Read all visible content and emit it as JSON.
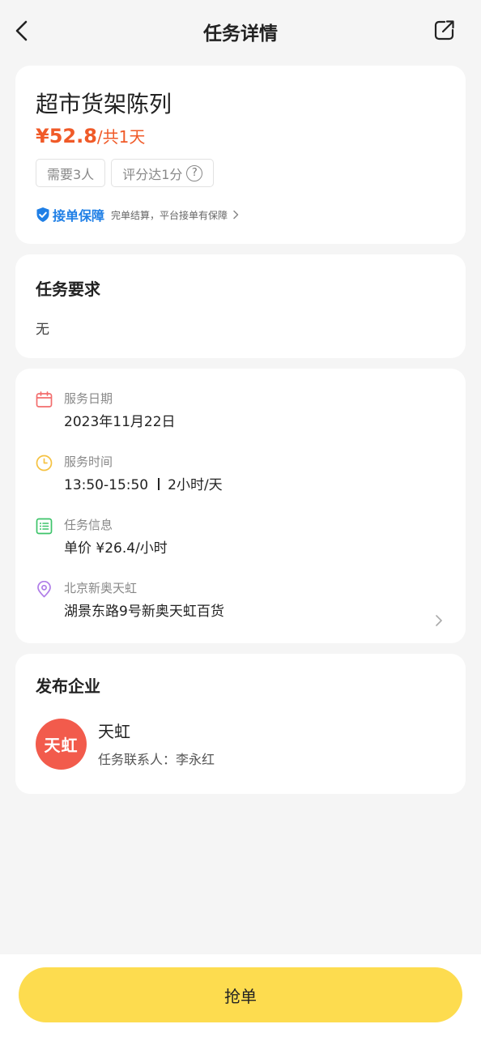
{
  "header": {
    "title": "任务详情"
  },
  "task": {
    "name": "超市货架陈列",
    "price": "¥52.8",
    "price_suffix": "/共1天",
    "tags": [
      "需要3人",
      "评分达1分"
    ],
    "guarantee_title": "接单保障",
    "guarantee_desc": "完单结算，平台接单有保障"
  },
  "requirements": {
    "title": "任务要求",
    "text": "无"
  },
  "details": {
    "date_label": "服务日期",
    "date_value": "2023年11月22日",
    "time_label": "服务时间",
    "time_range": "13:50-15:50",
    "time_duration": "2小时/天",
    "info_label": "任务信息",
    "info_value": "单价 ¥26.4/小时",
    "location_label": "北京新奥天虹",
    "location_value": "湖景东路9号新奥天虹百货"
  },
  "company": {
    "title": "发布企业",
    "logo_text": "天虹",
    "name": "天虹",
    "contact": "任务联系人：李永红"
  },
  "action": {
    "grab_label": "抢单"
  },
  "colors": {
    "accent": "#fddc4f",
    "price": "#f05a28",
    "guarantee": "#1f7fe6",
    "logo_bg": "#f25b4c"
  }
}
